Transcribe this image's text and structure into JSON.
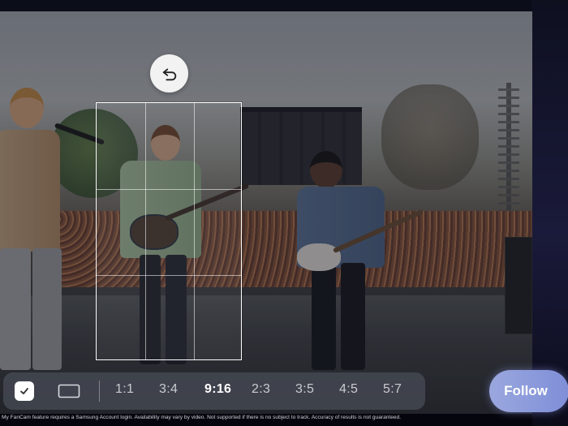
{
  "app": {
    "undo_icon": "undo-icon",
    "toolbar": {
      "auto_select_icon": "checkbox-checked-icon",
      "frame_icon": "rectangle-frame-icon",
      "ratios": [
        "1:1",
        "3:4",
        "9:16",
        "2:3",
        "3:5",
        "4:5",
        "5:7"
      ],
      "active_ratio": "9:16"
    },
    "follow_label": "Follow",
    "disclaimer": "My FanCam feature requires a Samsung Account login. Availability may vary by video. Not supported if there is no subject to track. Accuracy of results is not guaranteed."
  }
}
